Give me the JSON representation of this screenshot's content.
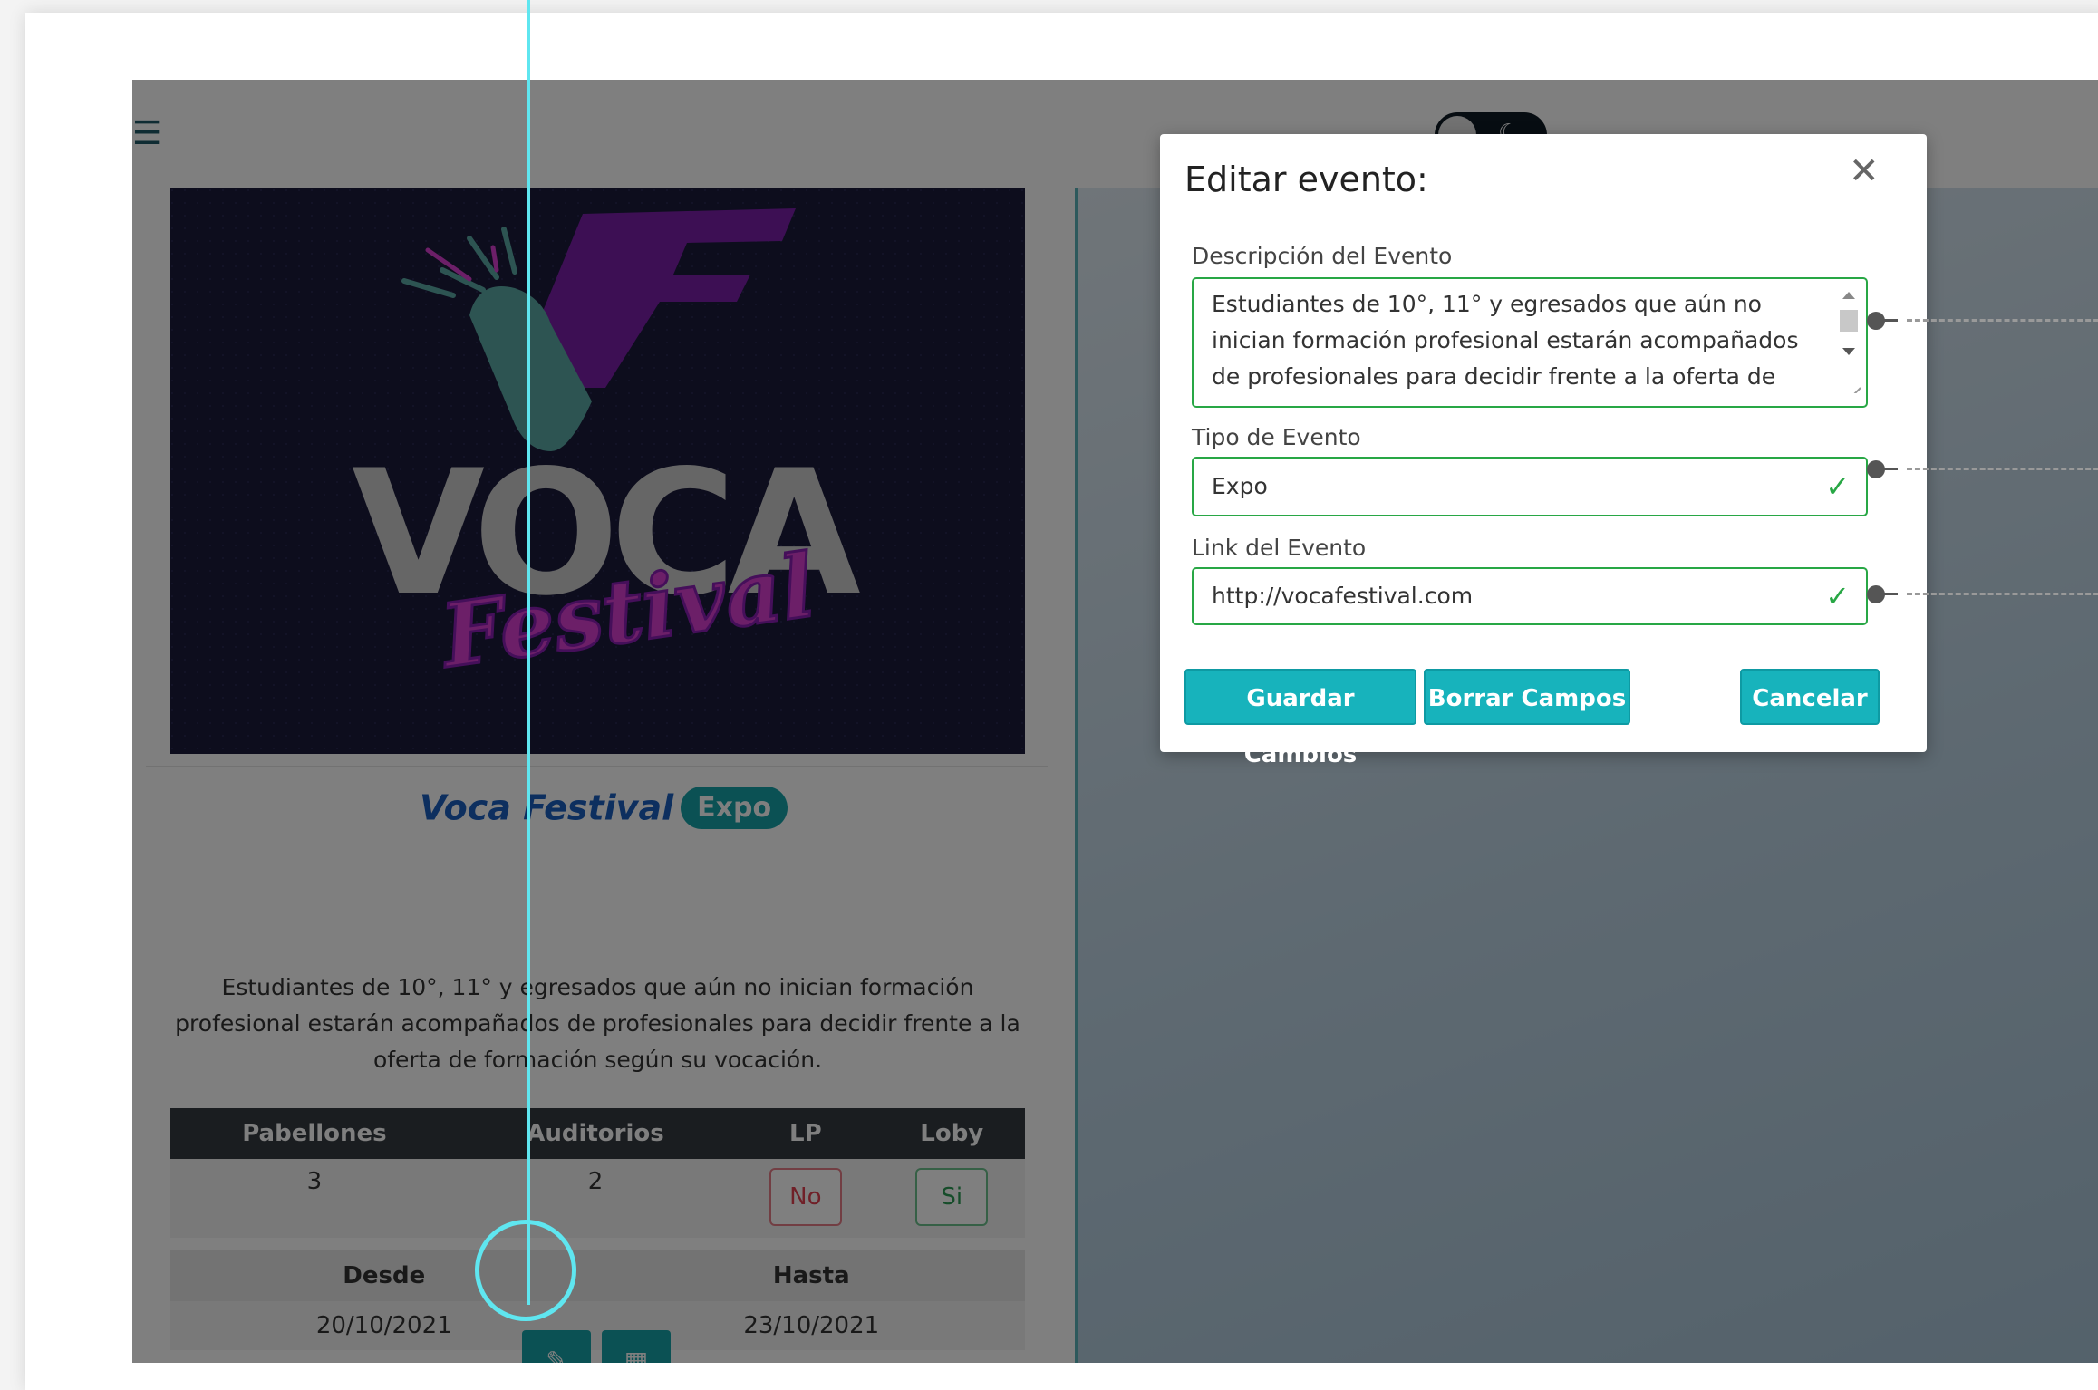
{
  "topbar": {
    "menu_icon": "hamburger-icon",
    "theme_toggle_icon": "moon-icon"
  },
  "event_card": {
    "name": "Voca Festival",
    "type_badge": "Expo",
    "description": "Estudiantes de 10°, 11° y egresados que aún no inician formación profesional estarán acompañados de profesionales para decidir frente a la oferta de formación según su vocación.",
    "poster": {
      "logo_text_main": "VOCA",
      "logo_text_script": "Festival",
      "logo_letter": "F",
      "colors": {
        "background": "#1a1a3a",
        "teal": "#5aa9a4",
        "purple": "#8a1fb5",
        "magenta": "#d93fd0",
        "gray": "#c9c9c9"
      }
    },
    "stats_table": {
      "headers": [
        "Pabellones",
        "Auditorios",
        "LP",
        "Loby"
      ],
      "values": {
        "pabellones": "3",
        "auditorios": "2",
        "lp": "No",
        "loby": "Si"
      }
    },
    "dates_table": {
      "headers": [
        "Desde",
        "Hasta"
      ],
      "values": {
        "desde": "20/10/2021",
        "hasta": "23/10/2021"
      }
    },
    "actions": {
      "edit_icon": "pencil-icon",
      "calendar_icon": "calendar-icon"
    }
  },
  "modal": {
    "title": "Editar evento:",
    "close_icon": "close-icon",
    "fields": {
      "description": {
        "label": "Descripción del Evento",
        "value": "Estudiantes de 10°, 11° y egresados que aún no\ninician formación profesional estarán acompañados\nde profesionales para decidir frente a la oferta de"
      },
      "type": {
        "label": "Tipo de Evento",
        "value": "Expo"
      },
      "link": {
        "label": "Link del Evento",
        "value": "http://vocafestival.com"
      }
    },
    "buttons": {
      "save": "Guardar Cambios",
      "clear": "Borrar Campos",
      "cancel": "Cancelar"
    }
  },
  "colors": {
    "accent": "#17a2a8",
    "valid": "#28a745",
    "annotation": "#5fe6f0",
    "overlay": "rgba(0,0,0,0.5)"
  }
}
